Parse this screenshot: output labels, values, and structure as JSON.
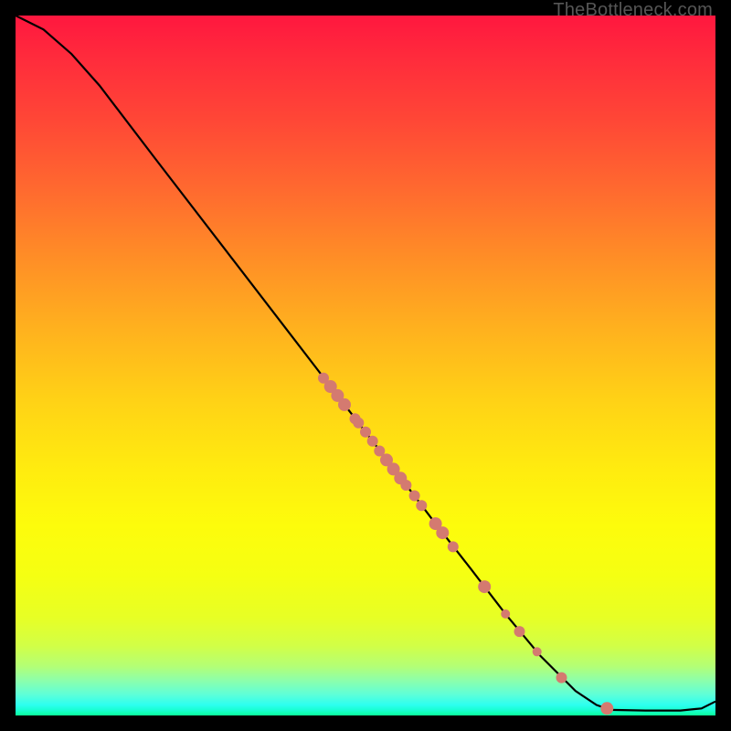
{
  "watermark": "TheBottleneck.com",
  "chart_data": {
    "type": "line",
    "title": "",
    "xlabel": "",
    "ylabel": "",
    "xlim": [
      0,
      100
    ],
    "ylim": [
      0,
      100
    ],
    "grid": false,
    "curve": [
      {
        "x": 0.0,
        "y": 100.0
      },
      {
        "x": 4.0,
        "y": 98.0
      },
      {
        "x": 8.0,
        "y": 94.5
      },
      {
        "x": 12.0,
        "y": 90.0
      },
      {
        "x": 20.0,
        "y": 79.5
      },
      {
        "x": 30.0,
        "y": 66.5
      },
      {
        "x": 40.0,
        "y": 53.5
      },
      {
        "x": 45.0,
        "y": 47.0
      },
      {
        "x": 50.0,
        "y": 40.5
      },
      {
        "x": 55.0,
        "y": 34.0
      },
      {
        "x": 60.0,
        "y": 27.4
      },
      {
        "x": 65.0,
        "y": 21.0
      },
      {
        "x": 70.0,
        "y": 14.5
      },
      {
        "x": 75.0,
        "y": 8.5
      },
      {
        "x": 80.0,
        "y": 3.5
      },
      {
        "x": 83.0,
        "y": 1.5
      },
      {
        "x": 85.0,
        "y": 0.8
      },
      {
        "x": 90.0,
        "y": 0.7
      },
      {
        "x": 95.0,
        "y": 0.7
      },
      {
        "x": 98.0,
        "y": 1.0
      },
      {
        "x": 100.0,
        "y": 2.0
      }
    ],
    "markers": [
      {
        "x": 44.0,
        "y": 48.2,
        "r": 6
      },
      {
        "x": 45.0,
        "y": 47.0,
        "r": 7
      },
      {
        "x": 46.0,
        "y": 45.7,
        "r": 7
      },
      {
        "x": 47.0,
        "y": 44.4,
        "r": 7
      },
      {
        "x": 48.5,
        "y": 42.4,
        "r": 6
      },
      {
        "x": 49.0,
        "y": 41.8,
        "r": 6
      },
      {
        "x": 50.0,
        "y": 40.5,
        "r": 6
      },
      {
        "x": 51.0,
        "y": 39.2,
        "r": 6
      },
      {
        "x": 52.0,
        "y": 37.8,
        "r": 6
      },
      {
        "x": 53.0,
        "y": 36.5,
        "r": 7
      },
      {
        "x": 54.0,
        "y": 35.2,
        "r": 7
      },
      {
        "x": 55.0,
        "y": 33.9,
        "r": 7
      },
      {
        "x": 55.8,
        "y": 32.9,
        "r": 6
      },
      {
        "x": 57.0,
        "y": 31.4,
        "r": 6
      },
      {
        "x": 58.0,
        "y": 30.0,
        "r": 6
      },
      {
        "x": 60.0,
        "y": 27.4,
        "r": 7
      },
      {
        "x": 61.0,
        "y": 26.1,
        "r": 7
      },
      {
        "x": 62.5,
        "y": 24.1,
        "r": 6
      },
      {
        "x": 67.0,
        "y": 18.4,
        "r": 7
      },
      {
        "x": 70.0,
        "y": 14.5,
        "r": 5
      },
      {
        "x": 72.0,
        "y": 12.0,
        "r": 6
      },
      {
        "x": 74.5,
        "y": 9.1,
        "r": 5
      },
      {
        "x": 78.0,
        "y": 5.4,
        "r": 6
      },
      {
        "x": 84.5,
        "y": 1.0,
        "r": 7
      }
    ],
    "marker_color": "#d47a70",
    "line_color": "#000000"
  }
}
